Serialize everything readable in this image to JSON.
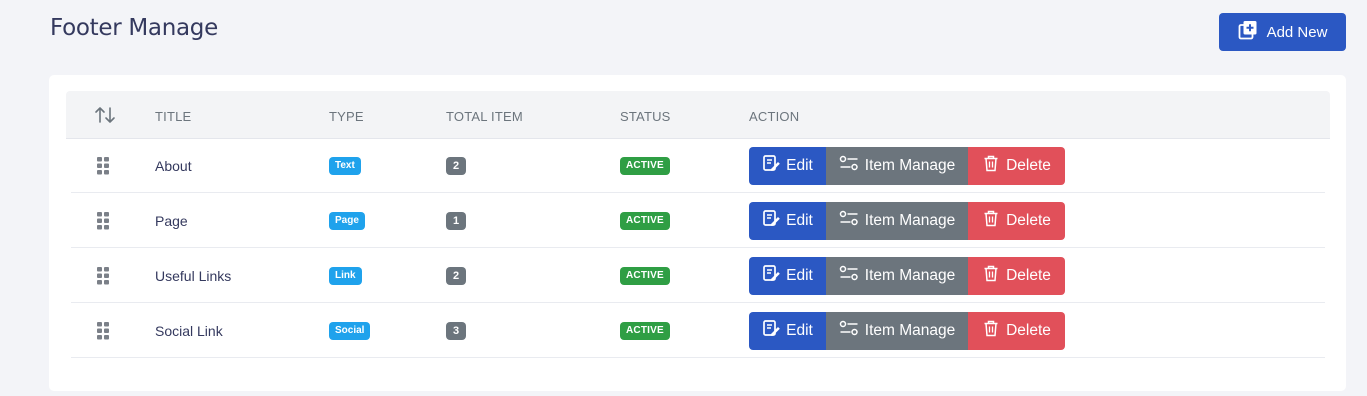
{
  "header": {
    "title": "Footer Manage",
    "add_button_label": "Add New"
  },
  "table": {
    "columns": [
      "TITLE",
      "TYPE",
      "TOTAL ITEM",
      "STATUS",
      "ACTION"
    ],
    "rows": [
      {
        "title": "About",
        "type": "Text",
        "total": "2",
        "status": "ACTIVE"
      },
      {
        "title": "Page",
        "type": "Page",
        "total": "1",
        "status": "ACTIVE"
      },
      {
        "title": "Useful Links",
        "type": "Link",
        "total": "2",
        "status": "ACTIVE"
      },
      {
        "title": "Social Link",
        "type": "Social",
        "total": "3",
        "status": "ACTIVE"
      }
    ],
    "actions": {
      "edit_label": "Edit",
      "item_manage_label": "Item Manage",
      "delete_label": "Delete"
    }
  },
  "colors": {
    "primary": "#2b58c3",
    "secondary": "#6c757d",
    "danger": "#e1505a",
    "success": "#2f9e44",
    "info": "#1fa2ec"
  },
  "icons": {
    "add": "add-copy-icon",
    "sort": "sort-arrows-icon",
    "drag": "drag-handle-icon",
    "edit": "edit-note-icon",
    "item_manage": "sliders-icon",
    "delete": "trash-icon"
  }
}
